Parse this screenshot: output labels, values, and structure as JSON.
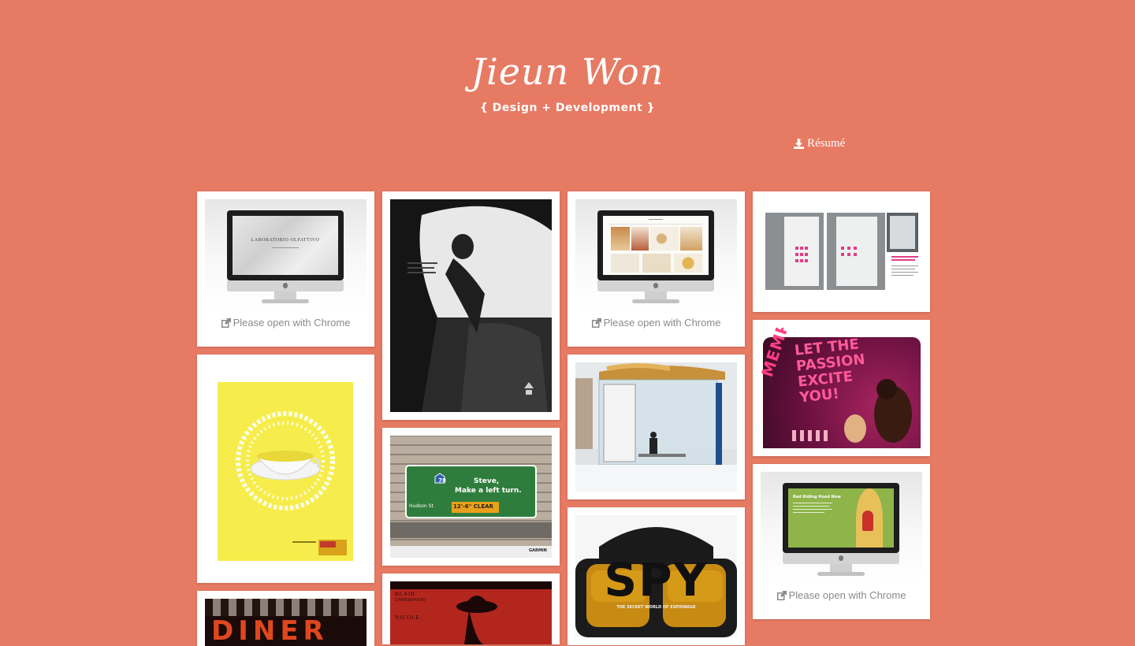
{
  "header": {
    "title": "Jieun Won",
    "subtitle": "{ Design + Development }",
    "resume_label": "Résumé"
  },
  "colors": {
    "background": "#e77a63",
    "card": "#ffffff",
    "note_text": "#8a8a8a"
  },
  "icons": {
    "resume": "download-icon",
    "external": "external-link-icon"
  },
  "portfolio": {
    "chrome_note": "Please open with Chrome",
    "items": [
      {
        "name": "Laboratorio Olfattivo website",
        "screen_text": "LABORATORIO OLFATTIVO"
      },
      {
        "name": "Camellia car advertisement"
      },
      {
        "name": "Restaurant website"
      },
      {
        "name": "Editorial book layout"
      },
      {
        "name": "Memphis musical ad",
        "headline": "MEMPHIS",
        "tagline": "LET THE PASSION EXCITE YOU!"
      },
      {
        "name": "Tea cup poster"
      },
      {
        "name": "Garmin billboard",
        "sign_line1": "Steve,",
        "sign_line2": "Make a left turn.",
        "clearance": "12'-6\" CLEAR",
        "street": "Hudson St",
        "route": "78",
        "brand": "GARMIN"
      },
      {
        "name": "Bus shelter ad"
      },
      {
        "name": "Little Red Riding Hood website",
        "screen_text": "Red Riding Hood Now"
      },
      {
        "name": "Diner poster",
        "headline": "DINER"
      },
      {
        "name": "Blair Underwood theater poster",
        "line1": "BLAIR",
        "line2": "UNDERWOOD",
        "line3": "NICOLE"
      },
      {
        "name": "Spy exhibition ad",
        "headline": "SPY",
        "tagline": "THE SECRET WORLD OF ESPIONAGE"
      }
    ]
  }
}
